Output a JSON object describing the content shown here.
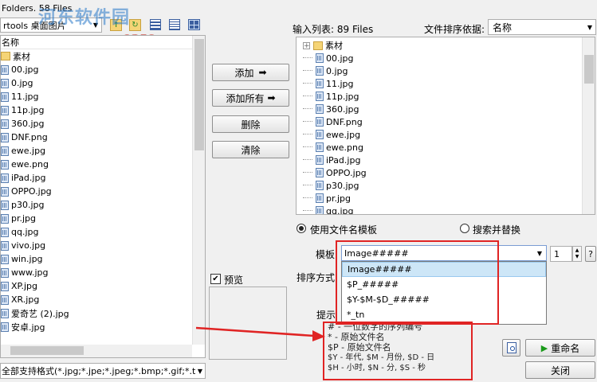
{
  "top": {
    "folders_label": "Folders. 58 Files",
    "path_value": "rtools 桌面图片",
    "watermark_text": "河东软件园",
    "watermark_url": "www.pc0359.cn"
  },
  "left_list": {
    "header": "名称",
    "items": [
      {
        "name": "素材",
        "type": "folder"
      },
      {
        "name": "00.jpg",
        "type": "file"
      },
      {
        "name": "0.jpg",
        "type": "file"
      },
      {
        "name": "11.jpg",
        "type": "file"
      },
      {
        "name": "11p.jpg",
        "type": "file"
      },
      {
        "name": "360.jpg",
        "type": "file"
      },
      {
        "name": "DNF.png",
        "type": "file"
      },
      {
        "name": "ewe.jpg",
        "type": "file"
      },
      {
        "name": "ewe.png",
        "type": "file"
      },
      {
        "name": "iPad.jpg",
        "type": "file"
      },
      {
        "name": "OPPO.jpg",
        "type": "file"
      },
      {
        "name": "p30.jpg",
        "type": "file"
      },
      {
        "name": "pr.jpg",
        "type": "file"
      },
      {
        "name": "qq.jpg",
        "type": "file"
      },
      {
        "name": "vivo.jpg",
        "type": "file"
      },
      {
        "name": "win.jpg",
        "type": "file"
      },
      {
        "name": "www.jpg",
        "type": "file"
      },
      {
        "name": "XP.jpg",
        "type": "file"
      },
      {
        "name": "XR.jpg",
        "type": "file"
      },
      {
        "name": "爱奇艺 (2).jpg",
        "type": "file"
      },
      {
        "name": "安卓.jpg",
        "type": "file"
      }
    ],
    "filter_value": "全部支持格式(*.jpg;*.jpe;*.jpeg;*.bmp;*.gif;*.t"
  },
  "middle_buttons": {
    "add": "添加",
    "add_all": "添加所有",
    "delete": "删除",
    "clear": "清除",
    "preview_label": "预览"
  },
  "right": {
    "input_list_label": "输入列表: 89 Files",
    "sort_label": "文件排序依据:",
    "sort_value": "名称",
    "items": [
      {
        "name": "素材",
        "type": "folder"
      },
      {
        "name": "00.jpg",
        "type": "file"
      },
      {
        "name": "0.jpg",
        "type": "file"
      },
      {
        "name": "11.jpg",
        "type": "file"
      },
      {
        "name": "11p.jpg",
        "type": "file"
      },
      {
        "name": "360.jpg",
        "type": "file"
      },
      {
        "name": "DNF.png",
        "type": "file"
      },
      {
        "name": "ewe.jpg",
        "type": "file"
      },
      {
        "name": "ewe.png",
        "type": "file"
      },
      {
        "name": "iPad.jpg",
        "type": "file"
      },
      {
        "name": "OPPO.jpg",
        "type": "file"
      },
      {
        "name": "p30.jpg",
        "type": "file"
      },
      {
        "name": "pr.jpg",
        "type": "file"
      },
      {
        "name": "qq.jpg",
        "type": "file"
      }
    ],
    "use_template_label": "使用文件名模板",
    "search_replace_label": "搜索并替换",
    "template_label": "模板",
    "template_value": "Image#####",
    "template_options": [
      "Image#####",
      "$P_#####",
      "$Y-$M-$D_#####",
      "*_tn"
    ],
    "counter_value": "1",
    "help_button": "?",
    "sort_method_label": "排序方式",
    "hint_label": "提示",
    "hints": [
      "# - 一位数字的序列编号",
      "*   - 原始文件名",
      "$P - 原始文件名",
      "$Y - 年代,     $M - 月份,     $D - 日",
      "$H - 小时,     $N - 分,     $S - 秒"
    ],
    "rename_button": "重命名",
    "close_button": "关闭"
  }
}
